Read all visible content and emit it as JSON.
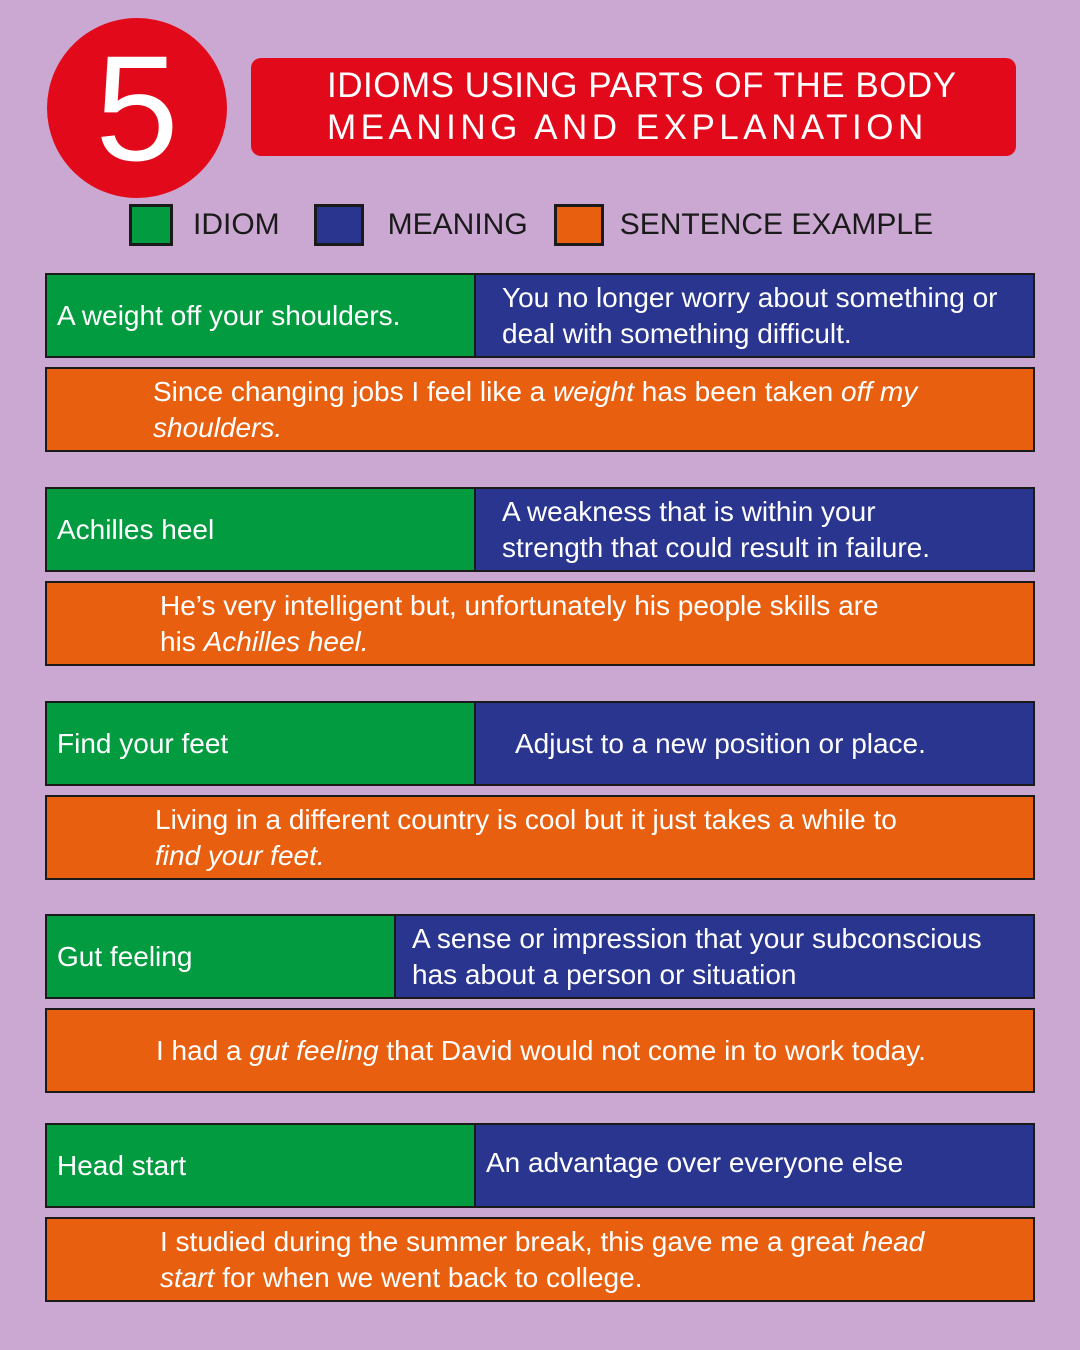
{
  "header": {
    "number": "5",
    "title_line1": "IDIOMS USING PARTS OF THE BODY",
    "title_line2": "MEANING AND EXPLANATION"
  },
  "legend": {
    "idiom": "IDIOM",
    "meaning": "MEANING",
    "example": "SENTENCE EXAMPLE"
  },
  "colors": {
    "idiom": "#039b40",
    "meaning": "#2a358f",
    "example": "#e8600f",
    "accent": "#e20a1a",
    "background": "#cba8d2"
  },
  "idioms": [
    {
      "idiom": "A weight off your shoulders.",
      "meaning": "You no longer worry about something or deal with something difficult.",
      "example": {
        "p1": "Since changing jobs I feel like a ",
        "i1": "weight",
        "p2": " has been taken ",
        "i2": "off my shoulders.",
        "p3": ""
      }
    },
    {
      "idiom": "Achilles heel",
      "meaning": "A weakness that is within your strength that could result in failure.",
      "example": {
        "p1": "He’s very intelligent but, unfortunately his people skills are his ",
        "i1": "Achilles heel.",
        "p2": "",
        "i2": "",
        "p3": ""
      }
    },
    {
      "idiom": "Find your feet",
      "meaning": "Adjust to a new position or place.",
      "example": {
        "p1": "Living in a different country is cool but it just takes a while to ",
        "i1": "find your feet.",
        "p2": "",
        "i2": "",
        "p3": ""
      }
    },
    {
      "idiom": "Gut feeling",
      "meaning": "A sense or impression that your subconscious has about a person or situation",
      "example": {
        "p1": "I had a ",
        "i1": "gut feeling",
        "p2": " that David would not come in to work today.",
        "i2": "",
        "p3": ""
      }
    },
    {
      "idiom": "Head start",
      "meaning": "An advantage over everyone else",
      "example": {
        "p1": "I studied during the summer break, this gave me  a great ",
        "i1": "head start",
        "p2": " for when we went back to college.",
        "i2": "",
        "p3": ""
      }
    }
  ]
}
